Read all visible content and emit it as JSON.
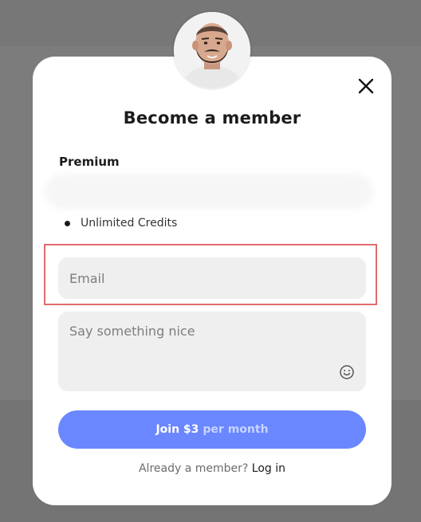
{
  "modal": {
    "title": "Become a member",
    "close_icon": "close-icon",
    "tier": {
      "name": "Premium",
      "perks": [
        "Unlimited Credits"
      ]
    },
    "email_field": {
      "placeholder": "Email",
      "value": ""
    },
    "message_field": {
      "placeholder": "Say something nice",
      "value": ""
    },
    "emoji_icon": "smiley-icon",
    "join_button": {
      "main_label": "Join $3",
      "period_label": "per month"
    },
    "footer": {
      "prompt": "Already a member?",
      "login_label": "Log in"
    }
  },
  "colors": {
    "accent": "#6a87ff",
    "highlight_border": "#e06c6c",
    "field_bg": "#efefef",
    "overlay": "#7c7c7c"
  }
}
